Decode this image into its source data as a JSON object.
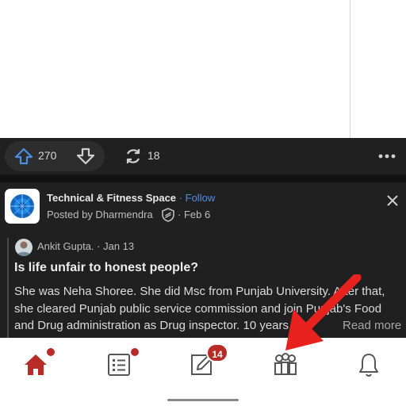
{
  "action_bar": {
    "upvote_icon": "arrow-up-icon",
    "upvote_count": "270",
    "downvote_icon": "arrow-down-icon",
    "share_icon": "refresh-share-icon",
    "share_count": "18",
    "more_icon": "more-horizontal-icon"
  },
  "post": {
    "space_name": "Technical & Fitness Space",
    "follow_separator": "·",
    "follow_label": "Follow",
    "posted_by": "Posted by Dharmendra",
    "posted_date": "· Feb 6",
    "close_icon": "close-icon",
    "author_line": "Ankit Gupta. · Jan 13",
    "question": "Is life unfair to honest people?",
    "answer_lines": [
      "She was Neha Shoree. She did Msc from Punjab University. After that,",
      "she cleared Punjab public service commission and join Punjab's Food",
      "and Drug administration as Drug inspector. 10 years ago"
    ],
    "read_more": "Read more"
  },
  "bottom_nav": {
    "items": [
      {
        "name": "home",
        "icon": "home-icon",
        "has_dot": true
      },
      {
        "name": "following",
        "icon": "list-icon",
        "has_dot": true
      },
      {
        "name": "answer",
        "icon": "edit-icon",
        "badge": "14"
      },
      {
        "name": "spaces",
        "icon": "people-icon"
      },
      {
        "name": "notifications",
        "icon": "bell-icon"
      }
    ]
  },
  "colors": {
    "accent_red": "#b92b27",
    "link_blue": "#4a8fe7",
    "upvote_blue": "#4a8fe7",
    "dark_bg": "#202020"
  },
  "annotation": {
    "red_arrow": "pointing-arrow-annotation"
  }
}
